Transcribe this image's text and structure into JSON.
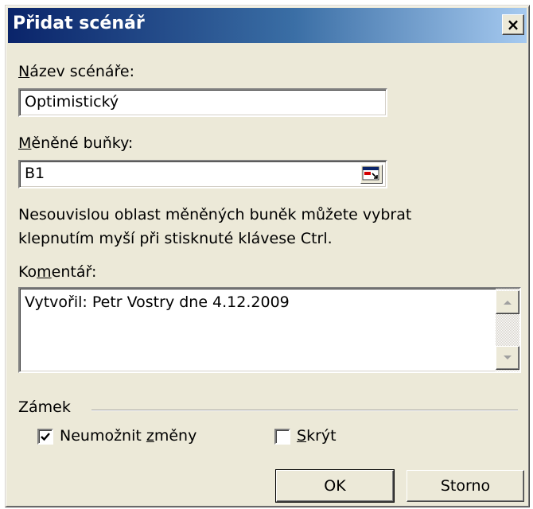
{
  "dialog": {
    "title": "Přidat scénář",
    "close_glyph": "×"
  },
  "scenario_name": {
    "label_first": "N",
    "label_rest": "ázev scénáře:",
    "value": "Optimistický"
  },
  "changing_cells": {
    "label_first": "M",
    "label_rest": "ěněné buňky:",
    "value": "B1",
    "icon": "collapse-dialog-icon"
  },
  "hint": {
    "line1": "Nesouvislou oblast měněných buněk můžete vybrat",
    "line2": "klepnutím myší při stisknuté klávese Ctrl."
  },
  "comment": {
    "label_first": "Ko",
    "label_underline": "m",
    "label_rest": "entář:",
    "value": "Vytvořil: Petr Vostry dne 4.12.2009"
  },
  "lock": {
    "group_label": "Zámek",
    "prevent_changes": {
      "label_first": "Neumožnit ",
      "label_underline": "z",
      "label_rest": "měny",
      "checked": true
    },
    "hide": {
      "label_underline": "S",
      "label_rest": "krýt",
      "checked": false
    }
  },
  "buttons": {
    "ok": "OK",
    "cancel": "Storno"
  }
}
